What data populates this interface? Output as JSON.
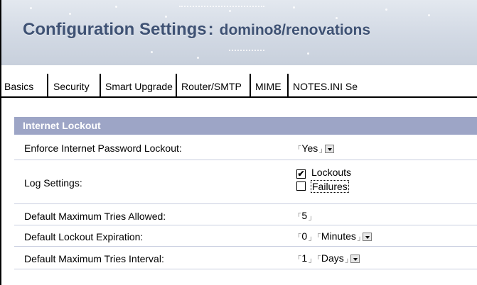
{
  "header": {
    "title": "Configuration Settings",
    "separator": ":",
    "database": "domino8/renovations"
  },
  "tabs": [
    {
      "label": "Basics"
    },
    {
      "label": "Security"
    },
    {
      "label": "Smart Upgrade"
    },
    {
      "label": "Router/SMTP"
    },
    {
      "label": "MIME"
    },
    {
      "label": "NOTES.INI Se"
    }
  ],
  "active_tab": "Security",
  "section": {
    "title": "Internet Lockout"
  },
  "fields": {
    "enforce_lockout": {
      "label": "Enforce Internet Password Lockout:",
      "value": "Yes"
    },
    "log_settings": {
      "label": "Log Settings:",
      "options": [
        {
          "label": "Lockouts",
          "checked": true,
          "mark": "✔"
        },
        {
          "label": "Failures",
          "checked": false,
          "mark": ""
        }
      ]
    },
    "max_tries": {
      "label": "Default Maximum Tries Allowed:",
      "value": "5"
    },
    "lockout_expiration": {
      "label": "Default Lockout Expiration:",
      "value": "0",
      "unit": "Minutes"
    },
    "tries_interval": {
      "label": "Default Maximum Tries Interval:",
      "value": "1",
      "unit": "Days"
    }
  },
  "colors": {
    "title": "#3f5274",
    "section_header_bg": "#9da5c6",
    "banner_bg": "#d2d9e4"
  },
  "icons": {
    "field_open": "field-open-bracket-icon",
    "field_close": "field-close-bracket-icon",
    "dropdown": "dropdown-arrow-icon",
    "checkbox": "checkbox-icon"
  }
}
